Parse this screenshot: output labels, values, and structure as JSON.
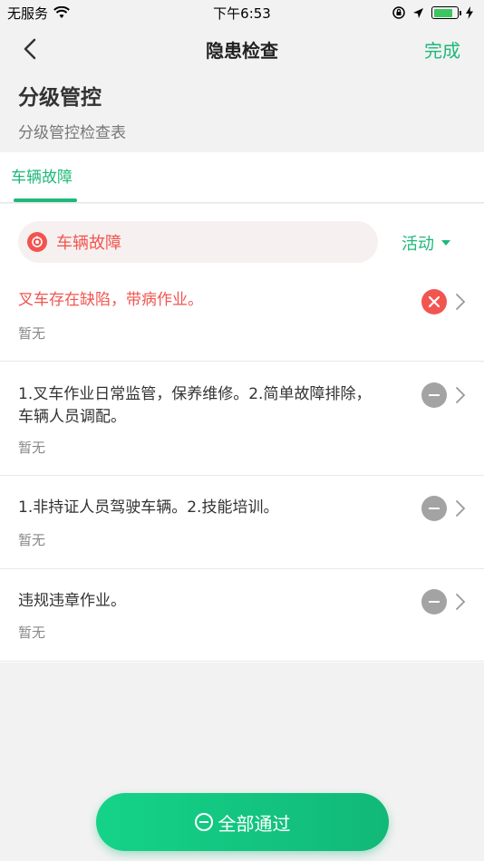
{
  "status_bar": {
    "carrier": "无服务",
    "time": "下午6:53",
    "battery_level": 0.8
  },
  "nav": {
    "title": "隐患检查",
    "done_label": "完成"
  },
  "header": {
    "title": "分级管控",
    "subtitle": "分级管控检查表"
  },
  "tabs": [
    {
      "label": "车辆故障",
      "active": true
    }
  ],
  "category": {
    "label": "车辆故障",
    "filter_label": "活动"
  },
  "items": [
    {
      "text": "叉车存在缺陷，带病作业。",
      "note": "暂无",
      "status": "fail"
    },
    {
      "text": "1.叉车作业日常监管，保养维修。2.简单故障排除，车辆人员调配。",
      "note": "暂无",
      "status": "neutral"
    },
    {
      "text": "1.非持证人员驾驶车辆。2.技能培训。",
      "note": "暂无",
      "status": "neutral"
    },
    {
      "text": "违规违章作业。",
      "note": "暂无",
      "status": "neutral"
    }
  ],
  "actions": {
    "pass_all_label": "全部通过"
  },
  "colors": {
    "accent": "#1fb87a",
    "danger": "#f2554f",
    "neutral": "#a3a3a3"
  }
}
